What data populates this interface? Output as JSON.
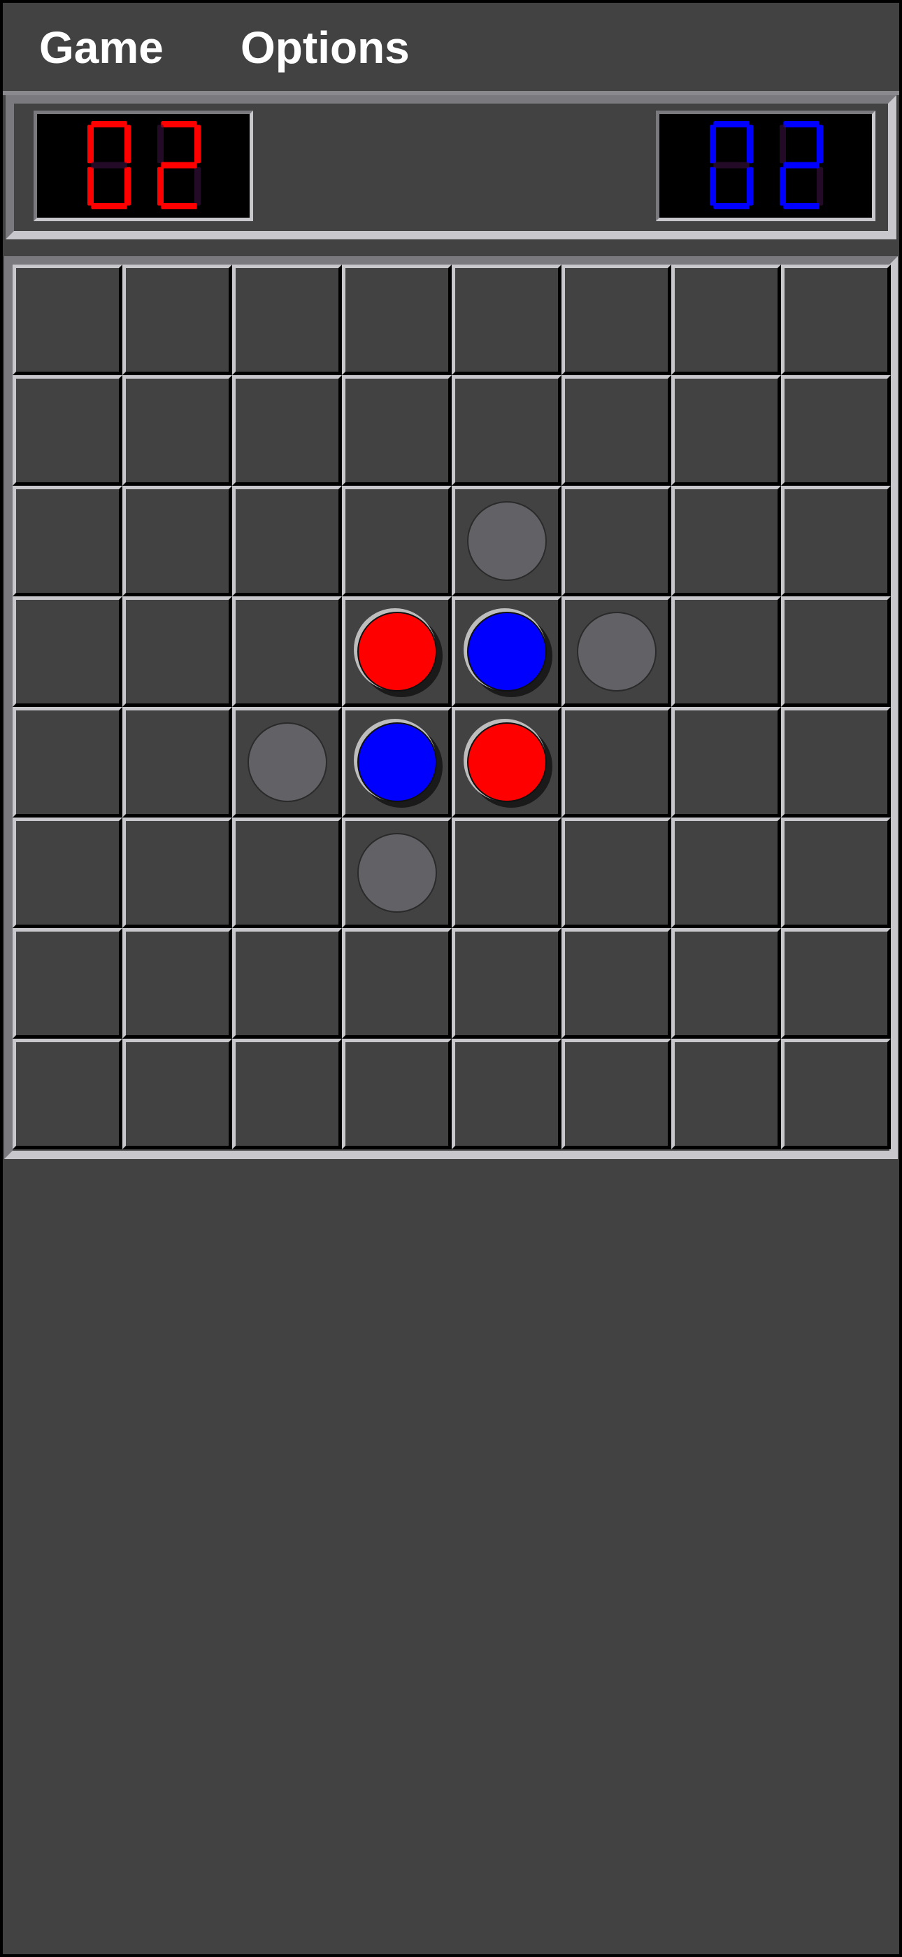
{
  "menu": {
    "game_label": "Game",
    "options_label": "Options"
  },
  "scores": {
    "red": {
      "value": "02",
      "color": "#ff0000"
    },
    "blue": {
      "value": "02",
      "color": "#0000ff"
    }
  },
  "board": {
    "rows": 8,
    "cols": 8,
    "pieces": [
      {
        "row": 3,
        "col": 3,
        "color": "red"
      },
      {
        "row": 3,
        "col": 4,
        "color": "blue"
      },
      {
        "row": 4,
        "col": 3,
        "color": "blue"
      },
      {
        "row": 4,
        "col": 4,
        "color": "red"
      }
    ],
    "valid_moves": [
      {
        "row": 2,
        "col": 4
      },
      {
        "row": 3,
        "col": 5
      },
      {
        "row": 4,
        "col": 2
      },
      {
        "row": 5,
        "col": 3
      }
    ]
  },
  "colors": {
    "background": "#424242",
    "red_piece": "#ff0000",
    "blue_piece": "#0000ff",
    "hint_piece": "#616166"
  }
}
